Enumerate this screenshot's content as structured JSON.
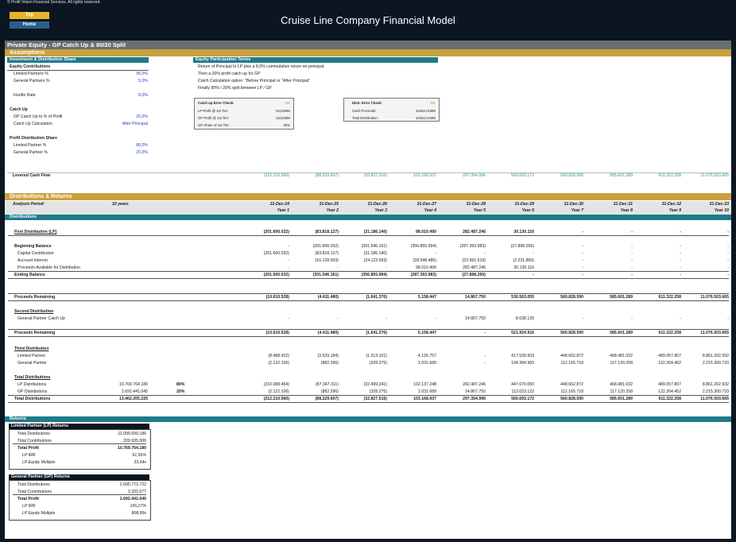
{
  "copyright": "© Profit Vision Financial Services. All rights reserved.",
  "nav": {
    "top": "Top",
    "home": "Home"
  },
  "title": "Cruise Line Company Financial Model",
  "sheet_title": "Private Equity - GP Catch Up & 80/20 Split",
  "assumptions": {
    "header": "Assumptions",
    "inv_header": "Investment & Distribution Share",
    "equity_contributions": "Equity Contributions",
    "lp_pct_label": "Limited Partners %",
    "lp_pct": "95,0%",
    "gp_pct_label": "General Partners %",
    "gp_pct": "5,0%",
    "hurdle_label": "Hurdle Rate",
    "hurdle": "8,0%",
    "catch_up": "Catch Up",
    "gp_catch_label": "GP Catch Up to % of Profit",
    "gp_catch": "20,0%",
    "catch_calc_label": "Catch Up Calculation",
    "catch_calc": "After Principal",
    "profit_share": "Profit Distribution Share",
    "lp2_label": "Limited Partner %",
    "lp2": "80,0%",
    "gp2_label": "General Partner %",
    "gp2": "20,0%"
  },
  "terms": {
    "header": "Equity Participation Terms",
    "lines": [
      "Return of Principal to LP plus a 8,0% cummulative return on principal.",
      "Then a 20% profit catch up for GP",
      "Catch Calculation option: \"Before Principal or \"After Principal\"",
      "Finally 80% / 20% split between LP / GP."
    ],
    "box1": {
      "check_label": "Catch up Error Check:",
      "check": "OK",
      "rows": [
        [
          "LP Profit @ 1st Tier:",
          "94,02MM"
        ],
        [
          "GP Profit @ 1st Tier:",
          "23,51MM"
        ],
        [
          "GP Share of 1st Tier:",
          "20%"
        ]
      ]
    },
    "box2": {
      "check_label": "Distr. Error Check:",
      "check": "OK",
      "rows": [
        [
          "Cash Proceeds:",
          "13462,21MM"
        ],
        [
          "Total Distribution:",
          "13462,21MM"
        ]
      ]
    }
  },
  "levered": {
    "label": "Levered Cash Flow",
    "values": [
      "(212.210.560)",
      "(88.229.607)",
      "(32.827.516)",
      "103.168.937",
      "297.354.996",
      "560.693.172",
      "560.828.590",
      "585.601.289",
      "611.322.258",
      "11.076.503.665"
    ]
  },
  "dist": {
    "header": "Distributions & Returns",
    "analysis_label": "Analysis Period",
    "analysis_value": "10 years",
    "dates": [
      "31-Dec-24",
      "31-Dec-25",
      "31-Dec-26",
      "31-Dec-27",
      "31-Dec-28",
      "31-Dec-29",
      "31-Dec-30",
      "31-Dec-31",
      "31-Dec-32",
      "31-Dec-33"
    ],
    "years": [
      "Year 1",
      "Year 2",
      "Year 3",
      "Year 4",
      "Year 5",
      "Year 6",
      "Year 7",
      "Year 8",
      "Year 9",
      "Year 10"
    ],
    "section": "Distributions",
    "first_dist": {
      "label": "First Distribution (LP)",
      "values": [
        "(201.600.032)",
        "(83.818.127)",
        "(31.186.140)",
        "98.010.490",
        "282.487.246",
        "30.130.116",
        "-",
        "-",
        "-",
        "-"
      ]
    },
    "beginning": {
      "label": "Beginning Balance",
      "values": [
        "-",
        "(201.600.032)",
        "(301.546.161)",
        "(356.855.994)",
        "(287.393.983)",
        "(27.898.256)",
        "-",
        "-",
        "-",
        "-"
      ]
    },
    "capital": {
      "label": "Capital Contribution",
      "values": [
        "(201.600.032)",
        "(83.818.127)",
        "(31.186.140)",
        "-",
        "-",
        "-",
        "-",
        "-",
        "-",
        "-"
      ]
    },
    "accrued": {
      "label": "Accrued Interest",
      "values": [
        "-",
        "(16.128.003)",
        "(24.123.693)",
        "(28.548.480)",
        "(22.991.519)",
        "(2.231.860)",
        "-",
        "-",
        "-",
        "-"
      ]
    },
    "proceeds_avail": {
      "label": "Proceeds Available for Distribution",
      "values": [
        "-",
        "-",
        "-",
        "98.010.490",
        "282.487.246",
        "30.130.116",
        "-",
        "-",
        "-",
        "-"
      ]
    },
    "ending": {
      "label": "Ending Balance",
      "values": [
        "(201.600.032)",
        "(301.546.161)",
        "(356.855.994)",
        "(287.393.983)",
        "(27.898.256)",
        "-",
        "-",
        "-",
        "-",
        "-"
      ]
    },
    "proceeds_rem1": {
      "label": "Proceeds Remaining",
      "values": [
        "(10.610.528)",
        "(4.411.480)",
        "(1.641.376)",
        "5.158.447",
        "14.867.750",
        "530.563.055",
        "560.828.590",
        "585.601.289",
        "611.322.258",
        "11.076.503.665"
      ]
    },
    "second": {
      "label": "Second Distribution"
    },
    "gp_catch": {
      "label": "General Partner Catch Up",
      "values": [
        "-",
        "-",
        "-",
        "-",
        "14.867.750",
        "8.638.139",
        "-",
        "-",
        "-",
        "-"
      ]
    },
    "proceeds_rem2": {
      "label": "Proceeds Remaining",
      "values": [
        "(10.610.528)",
        "(4.411.480)",
        "(1.641.376)",
        "5.158.447",
        "-",
        "521.924.916",
        "560.828.590",
        "585.601.289",
        "611.322.258",
        "11.076.503.665"
      ]
    },
    "third": {
      "label": "Third Distribution"
    },
    "third_lp": {
      "label": "Limited Partner",
      "values": [
        "(8.488.422)",
        "(3.529.184)",
        "(1.313.101)",
        "4.126.757",
        "-",
        "417.539.933",
        "448.662.872",
        "468.481.032",
        "489.057.807",
        "8.861.202.932"
      ]
    },
    "third_gp": {
      "label": "General Partner",
      "values": [
        "(2.122.106)",
        "(882.296)",
        "(328.275)",
        "1.031.689",
        "-",
        "104.384.983",
        "112.165.718",
        "117.120.258",
        "122.264.452",
        "2.215.300.733"
      ]
    },
    "total_dist": {
      "label": "Total Distributions"
    },
    "lp_dist": {
      "label": "LP Distributions",
      "total": "10.769.764.180",
      "pct": "80%",
      "values": [
        "(210.088.454)",
        "(87.347.311)",
        "(32.499.241)",
        "102.137.248",
        "282.487.246",
        "447.670.050",
        "448.662.872",
        "468.481.032",
        "489.057.807",
        "8.861.202.932"
      ]
    },
    "gp_dist": {
      "label": "GP Distributions",
      "total": "2.692.441.045",
      "pct": "20%",
      "values": [
        "(2.122.106)",
        "(882.296)",
        "(328.275)",
        "1.031.689",
        "14.867.750",
        "113.023.122",
        "112.165.718",
        "117.120.258",
        "122.264.452",
        "2.215.300.733"
      ]
    },
    "totals": {
      "label": "Total Distributions",
      "total": "13.462.205.225",
      "values": [
        "(212.210.560)",
        "(88.229.607)",
        "(32.827.516)",
        "103.168.937",
        "297.354.996",
        "560.693.172",
        "560.828.590",
        "585.601.289",
        "611.322.258",
        "11.076.503.665"
      ]
    }
  },
  "returns": {
    "header": "Returns",
    "lp": {
      "header": "Limited Partner (LP) Returns",
      "rows": [
        {
          "label": "Total Distributions",
          "value": "11.099.699.186"
        },
        {
          "label": "Total Contributions",
          "value": "329.935.006"
        },
        {
          "label": "Total Profit",
          "value": "10.769.764.180"
        },
        {
          "label": "LP IRR",
          "value": "61,56%"
        },
        {
          "label": "LP Equity Multiple",
          "value": "33,64x"
        }
      ]
    },
    "gp": {
      "header": "General Partner (GP) Returns",
      "rows": [
        {
          "label": "Total Distributions",
          "value": "2.695.773.722"
        },
        {
          "label": "Total Contributions",
          "value": "3.332.677"
        },
        {
          "label": "Total Profit",
          "value": "2.692.441.045"
        },
        {
          "label": "LP IRR",
          "value": "156,27%"
        },
        {
          "label": "LP Equity Multiple",
          "value": "808,89x"
        }
      ]
    }
  }
}
